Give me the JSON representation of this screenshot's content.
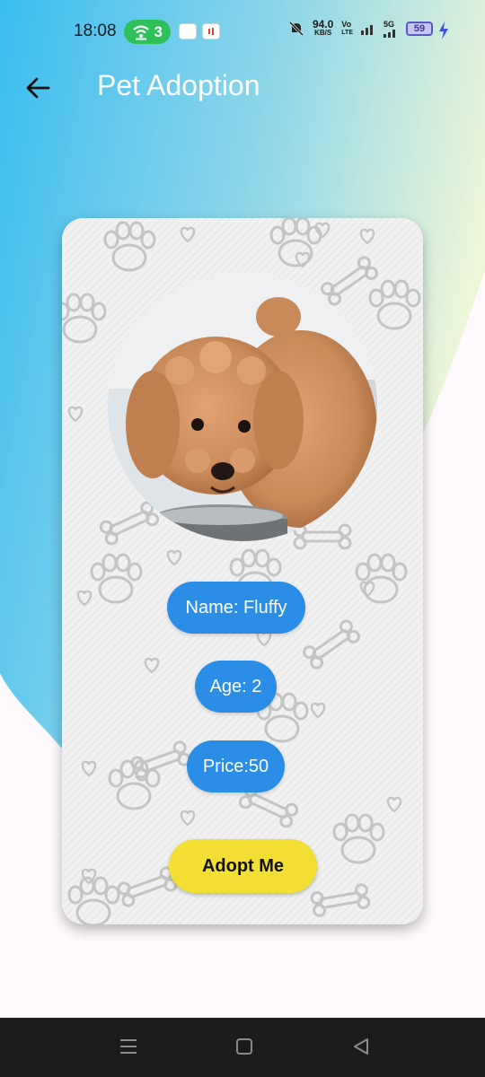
{
  "status_bar": {
    "time": "18:08",
    "hotspot_count": "3",
    "speed_value": "94.0",
    "speed_unit": "KB/S",
    "volte_top": "Vo",
    "volte_bottom": "LTE",
    "network": "5G",
    "battery": "59"
  },
  "app_bar": {
    "title": "Pet Adoption",
    "back_icon": "arrow-left-icon"
  },
  "pet": {
    "photo_description_icon": "dog-photo",
    "name_label": "Name: Fluffy",
    "age_label": "Age: 2",
    "price_label": "Price:50",
    "adopt_label": "Adopt Me"
  },
  "colors": {
    "pill_blue": "#2b8ee6",
    "adopt_yellow": "#f3df33",
    "gradient_start": "#3bbdf0",
    "gradient_end": "#eef6d8"
  },
  "nav_bar": {
    "menu_icon": "menu-icon",
    "home_icon": "square-home-icon",
    "back_icon": "triangle-back-icon"
  }
}
